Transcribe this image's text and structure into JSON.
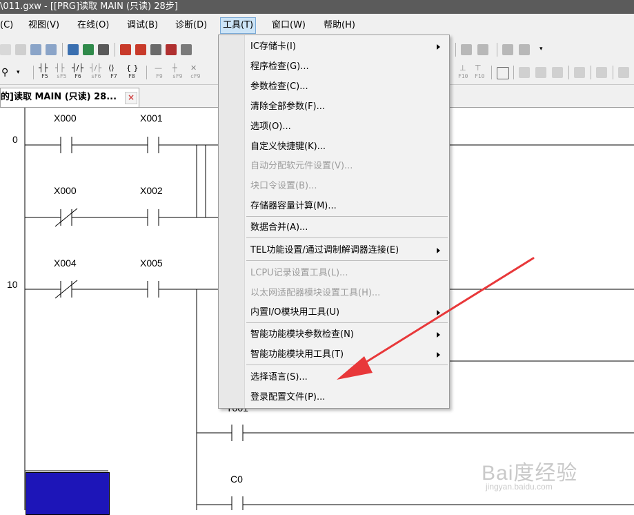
{
  "window": {
    "title": "\\011.gxw - [[PRG]读取 MAIN (只读) 28步]"
  },
  "menubar": {
    "items": [
      {
        "label": "(C)"
      },
      {
        "label": "视图(V)"
      },
      {
        "label": "在线(O)"
      },
      {
        "label": "调试(B)"
      },
      {
        "label": "诊断(D)"
      },
      {
        "label": "工具(T)"
      },
      {
        "label": "窗口(W)"
      },
      {
        "label": "帮助(H)"
      }
    ],
    "active": "工具(T)"
  },
  "toolbar2": {
    "fkeys": [
      "F5",
      "sF5",
      "F6",
      "sF6",
      "F7",
      "F8",
      "F9",
      "sF9",
      "cF9",
      "F10",
      "F10"
    ]
  },
  "tab": {
    "label": "的]读取 MAIN (只读) 28...",
    "close_glyph": "×"
  },
  "ladder": {
    "step_numbers": [
      "0",
      "10"
    ],
    "labels": [
      "X000",
      "X001",
      "X000",
      "X002",
      "X004",
      "X005",
      "T001",
      "C0"
    ]
  },
  "tools_menu": {
    "items": [
      {
        "label": "IC存储卡(I)",
        "submenu": true,
        "disabled": false
      },
      {
        "label": "程序检查(G)...",
        "submenu": false,
        "disabled": false
      },
      {
        "label": "参数检查(C)...",
        "submenu": false,
        "disabled": false
      },
      {
        "label": "清除全部参数(F)...",
        "submenu": false,
        "disabled": false
      },
      {
        "label": "选项(O)...",
        "submenu": false,
        "disabled": false
      },
      {
        "label": "自定义快捷键(K)...",
        "submenu": false,
        "disabled": false
      },
      {
        "label": "自动分配软元件设置(V)...",
        "submenu": false,
        "disabled": true
      },
      {
        "label": "块口令设置(B)...",
        "submenu": false,
        "disabled": true
      },
      {
        "label": "存储器容量计算(M)...",
        "submenu": false,
        "disabled": false
      },
      {
        "label": "数据合并(A)...",
        "submenu": false,
        "disabled": false
      },
      {
        "label": "TEL功能设置/通过调制解调器连接(E)",
        "submenu": true,
        "disabled": false
      },
      {
        "label": "LCPU记录设置工具(L)...",
        "submenu": false,
        "disabled": true
      },
      {
        "label": "以太网适配器模块设置工具(H)...",
        "submenu": false,
        "disabled": true
      },
      {
        "label": "内置I/O模块用工具(U)",
        "submenu": true,
        "disabled": false
      },
      {
        "label": "智能功能模块参数检查(N)",
        "submenu": true,
        "disabled": false
      },
      {
        "label": "智能功能模块用工具(T)",
        "submenu": true,
        "disabled": false
      },
      {
        "label": "选择语言(S)...",
        "submenu": false,
        "disabled": false
      },
      {
        "label": "登录配置文件(P)...",
        "submenu": false,
        "disabled": false
      }
    ]
  },
  "watermark": {
    "main": "Bai度经验",
    "sub": "jingyan.baidu.com"
  },
  "colors": {
    "annotation_arrow": "#e8383a",
    "selected_menu_bg": "#cce4f7",
    "blue_block": "#1d15b8"
  }
}
